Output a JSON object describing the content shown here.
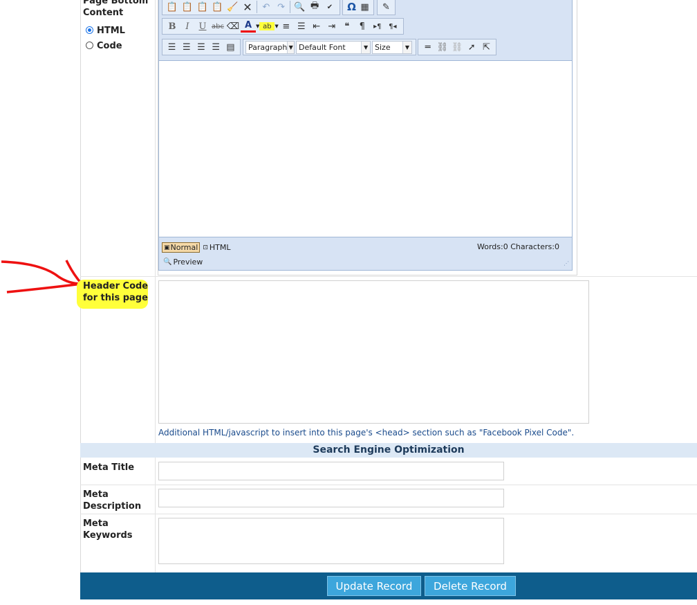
{
  "bottom_content": {
    "label_line1": "Page Bottom",
    "label_line2": "Content",
    "mode_html": "HTML",
    "mode_code": "Code",
    "selected_mode": "HTML"
  },
  "editor": {
    "toolbar_row1_icons": [
      "paste-icon",
      "paste-text-icon",
      "paste-word-icon",
      "paste-special-icon",
      "clean-icon",
      "cut-icon",
      "undo-icon",
      "redo-icon",
      "find-icon",
      "print-icon",
      "spellcheck-icon",
      "special-char-icon",
      "table-icon",
      "edit-icon"
    ],
    "block_format": "Paragraph",
    "font_name": "Default Font",
    "font_size": "Size",
    "mode_normal": "Normal",
    "mode_html": "HTML",
    "preview": "Preview",
    "stats": "Words:0 Characters:0",
    "bold": "B",
    "italic": "I",
    "underline": "U",
    "strike": "abc",
    "font_color_glyph": "A",
    "highlight_glyph": "ab",
    "omega": "Ω"
  },
  "header_code": {
    "label_line1": "Header Code",
    "label_line2": "for this page",
    "value": "",
    "hint": "Additional HTML/javascript to insert into this page's <head> section such as \"Facebook Pixel Code\"."
  },
  "seo": {
    "section_title": "Search Engine Optimization",
    "meta_title_label": "Meta Title",
    "meta_title_value": "",
    "meta_description_label_line1": "Meta",
    "meta_description_label_line2": "Description",
    "meta_description_value": "",
    "meta_keywords_label_line1": "Meta",
    "meta_keywords_label_line2": "Keywords",
    "meta_keywords_value": ""
  },
  "actions": {
    "update": "Update Record",
    "delete": "Delete Record"
  },
  "colors": {
    "highlight": "#ffff3a",
    "arrow": "#ee1111",
    "action_bar": "#0e5d8c",
    "button": "#3da6dc"
  }
}
